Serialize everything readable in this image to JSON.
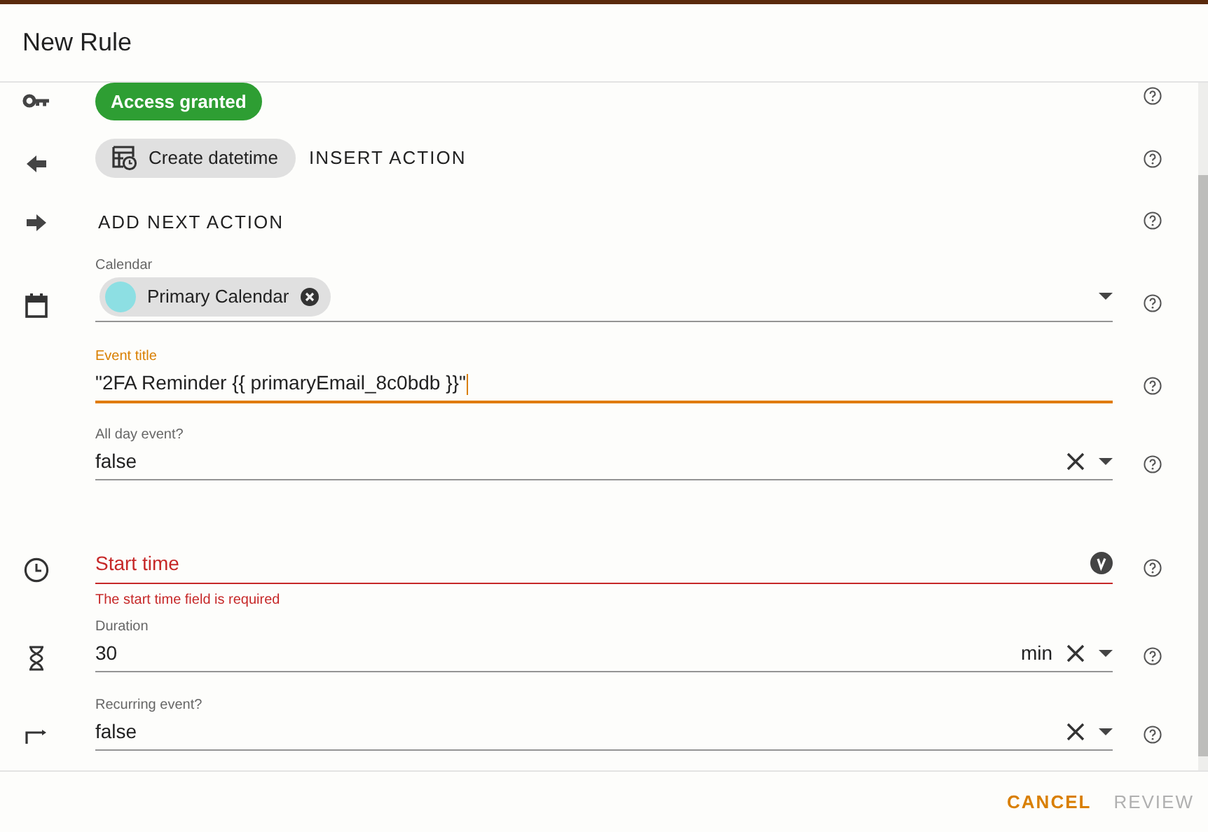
{
  "dialog": {
    "title": "New Rule"
  },
  "rows": [
    {
      "kind": "badge",
      "label": "Access granted"
    },
    {
      "kind": "chip_action",
      "chip": "Create datetime",
      "action": "INSERT ACTION"
    },
    {
      "kind": "action",
      "action": "ADD NEXT ACTION"
    },
    {
      "kind": "chip_select",
      "label": "Calendar",
      "chip": {
        "label": "Primary Calendar",
        "color": "#8ddfe3"
      }
    },
    {
      "kind": "text",
      "label": "Event title",
      "value": "\"2FA Reminder {{ primaryEmail_8c0bdb }}\"",
      "focused": true
    },
    {
      "kind": "select",
      "label": "All day event?",
      "value": "false",
      "clearable": true
    },
    {
      "kind": "variable",
      "placeholder": "Start time",
      "error": "The start time field is required"
    },
    {
      "kind": "select",
      "label": "Duration",
      "value": "30",
      "suffix": "min",
      "clearable": true
    },
    {
      "kind": "select",
      "label": "Recurring event?",
      "value": "false",
      "clearable": true
    }
  ],
  "footer": {
    "buttons": [
      {
        "label": "CANCEL",
        "disabled": false
      },
      {
        "label": "REVIEW",
        "disabled": true
      }
    ]
  }
}
